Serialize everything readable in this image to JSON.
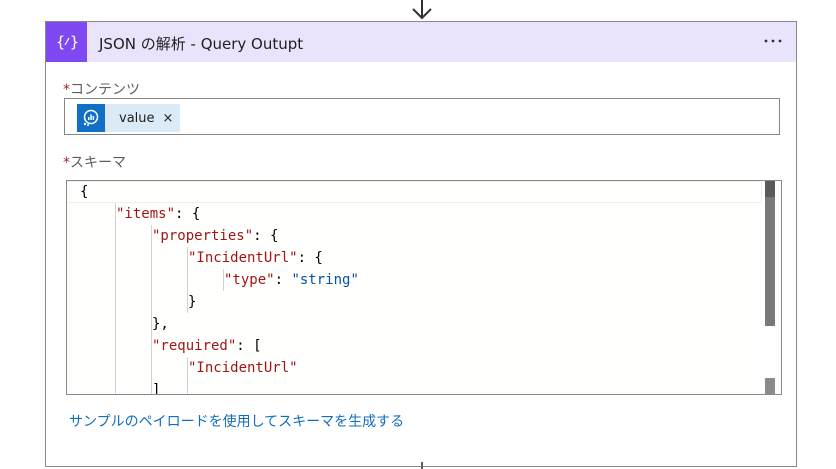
{
  "header": {
    "title": "JSON の解析 - Query Outupt",
    "more_label": "···"
  },
  "content_field": {
    "required_mark": "*",
    "label": "コンテンツ",
    "token_label": "value",
    "token_remove": "×"
  },
  "schema_field": {
    "required_mark": "*",
    "label": "スキーマ",
    "lines": [
      "{",
      "\"items\": {",
      "\"properties\": {",
      "\"IncidentUrl\": {",
      "\"type\": \"string\"",
      "}",
      "},",
      "\"required\": [",
      "\"IncidentUrl\""
    ]
  },
  "sample_link": "サンプルのペイロードを使用してスキーマを生成する",
  "colors": {
    "accent": "#8048f0",
    "header_bg": "#e9e3fb",
    "token_bg": "#daeaf7",
    "token_icon_bg": "#1170c6",
    "link": "#106ebe",
    "json_key": "#a31515",
    "json_string": "#0451a5",
    "required": "#a4262c"
  }
}
